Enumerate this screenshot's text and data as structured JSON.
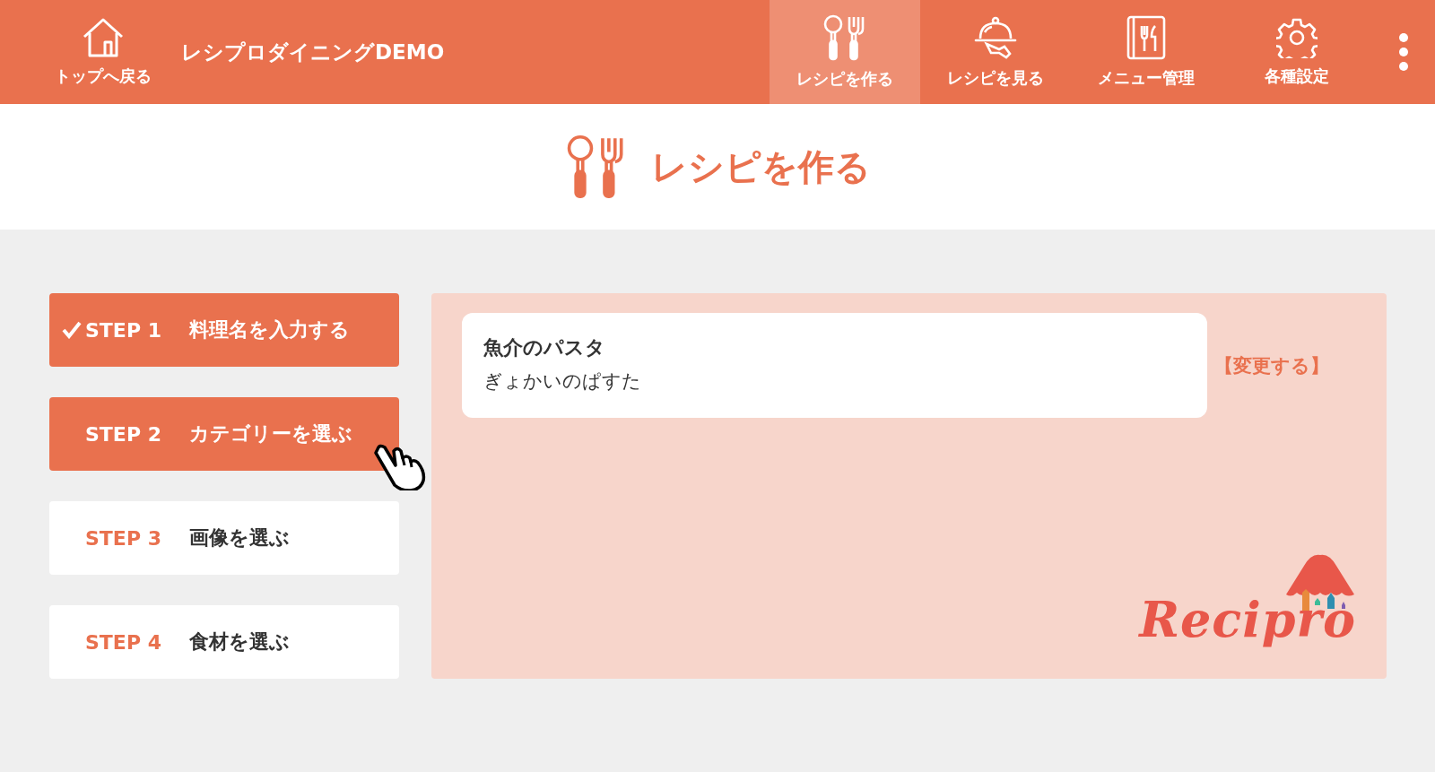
{
  "header": {
    "home": {
      "label": "トップへ戻る"
    },
    "app_title": "レシプロダイニングDEMO",
    "nav": [
      {
        "label": "レシピを作る",
        "kind": "utensils",
        "selected": true
      },
      {
        "label": "レシピを見る",
        "kind": "cloche",
        "selected": false
      },
      {
        "label": "メニュー管理",
        "kind": "menu-book",
        "selected": false
      },
      {
        "label": "各種設定",
        "kind": "gear",
        "selected": false
      }
    ]
  },
  "page_title": {
    "text": "レシピを作る"
  },
  "steps": [
    {
      "step": "STEP 1",
      "label": "料理名を入力する",
      "done": true,
      "active": true,
      "hover": false
    },
    {
      "step": "STEP 2",
      "label": "カテゴリーを選ぶ",
      "done": false,
      "active": true,
      "hover": true
    },
    {
      "step": "STEP 3",
      "label": "画像を選ぶ",
      "done": false,
      "active": false,
      "hover": false
    },
    {
      "step": "STEP 4",
      "label": "食材を選ぶ",
      "done": false,
      "active": false,
      "hover": false
    }
  ],
  "dish": {
    "name": "魚介のパスタ",
    "reading": "ぎょかいのぱすた",
    "change_link": "【変更する】"
  },
  "logo": {
    "text": "Recipro"
  }
}
